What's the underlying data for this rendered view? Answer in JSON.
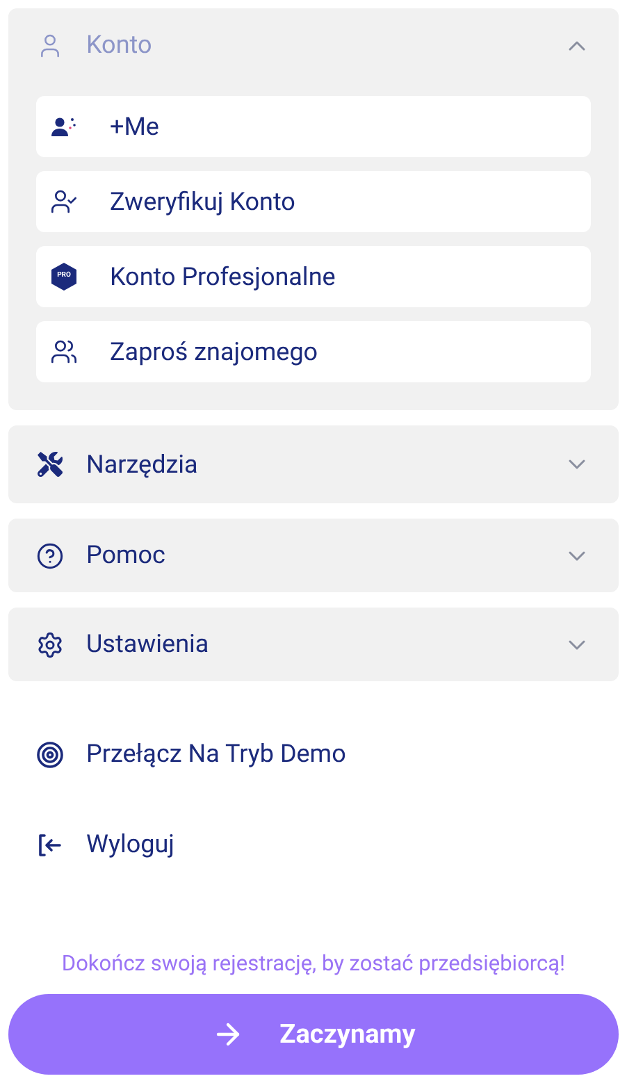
{
  "sections": [
    {
      "label": "Konto",
      "expanded": true,
      "children": [
        {
          "label": "+Me"
        },
        {
          "label": "Zweryfikuj Konto"
        },
        {
          "label": "Konto Profesjonalne",
          "badge": "PRO"
        },
        {
          "label": "Zaproś znajomego"
        }
      ]
    },
    {
      "label": "Narzędzia",
      "expanded": false
    },
    {
      "label": "Pomoc",
      "expanded": false
    },
    {
      "label": "Ustawienia",
      "expanded": false
    }
  ],
  "links": [
    {
      "label": "Przełącz Na Tryb Demo"
    },
    {
      "label": "Wyloguj"
    }
  ],
  "message": "Dokończ swoją rejestrację, by zostać przedsiębiorcą!",
  "cta": {
    "label": "Zaczynamy"
  }
}
